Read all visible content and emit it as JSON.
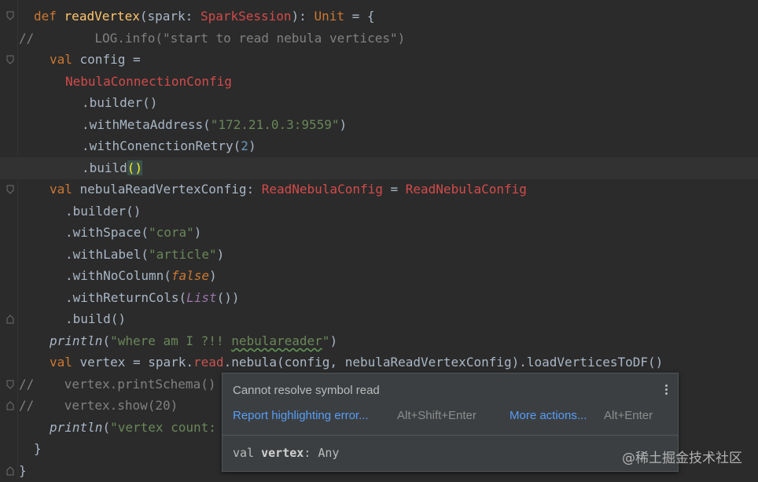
{
  "code": {
    "line1": {
      "kw": "def",
      "name": "readVertex",
      "p1": "(spark: ",
      "type": "SparkSession",
      "p2": "): ",
      "ret": "Unit",
      "p3": " = {"
    },
    "line2": {
      "cmt_prefix": "//",
      "text": "        LOG.info(\"start to read nebula vertices\")"
    },
    "line3": {
      "kw": "val",
      "text": " config ="
    },
    "line4": {
      "err": "NebulaConnectionConfig"
    },
    "line5": {
      "text": ".builder()"
    },
    "line6": {
      "pre": ".withMetaAddress(",
      "str": "\"172.21.0.3:9559\"",
      "post": ")"
    },
    "line7": {
      "pre": ".withConenctionRetry(",
      "num": "2",
      "post": ")"
    },
    "line8": {
      "pre": ".build",
      "paren": "()"
    },
    "line9": {
      "kw": "val",
      "pre": " nebulaReadVertexConfig: ",
      "err1": "ReadNebulaConfig",
      "mid": " = ",
      "err2": "ReadNebulaConfig"
    },
    "line10": {
      "text": ".builder()"
    },
    "line11": {
      "pre": ".withSpace(",
      "str": "\"cora\"",
      "post": ")"
    },
    "line12": {
      "pre": ".withLabel(",
      "str": "\"article\"",
      "post": ")"
    },
    "line13": {
      "pre": ".withNoColumn(",
      "kw": "false",
      "post": ")"
    },
    "line14": {
      "pre": ".withReturnCols(",
      "ital": "List",
      "post": "())"
    },
    "line15": {
      "text": ".build()"
    },
    "line16": {
      "fn": "println",
      "p1": "(",
      "str1": "\"where am I ?!! ",
      "typo": "nebulareader",
      "str2": "\"",
      "p2": ")"
    },
    "line17": {
      "kw": "val",
      "pre": " vertex = spark.",
      "err": "read",
      "post": ".nebula(config, nebulaReadVertexConfig).loadVerticesToDF()"
    },
    "line18": {
      "cmt": "//",
      "text": "    vertex.printSchema()"
    },
    "line19": {
      "cmt": "//",
      "text": "    vertex.show(20)"
    },
    "line20": {
      "fn": "println",
      "p1": "(",
      "str": "\"vertex count:"
    },
    "line21": {
      "text": "}"
    },
    "line22": {
      "text": "}"
    }
  },
  "popup": {
    "message": "Cannot resolve symbol read",
    "action1": "Report highlighting error...",
    "shortcut1": "Alt+Shift+Enter",
    "action2": "More actions...",
    "shortcut2": "Alt+Enter",
    "decl_kw": "val",
    "decl_name": "vertex",
    "decl_type": ": Any",
    "menu_icon": "more-vertical-icon"
  },
  "watermark": "@稀土掘金技术社区",
  "colors": {
    "background": "#2b2b2b",
    "keyword": "#cc7832",
    "string": "#6a8759",
    "error": "#d44b4b",
    "link": "#589df6"
  }
}
